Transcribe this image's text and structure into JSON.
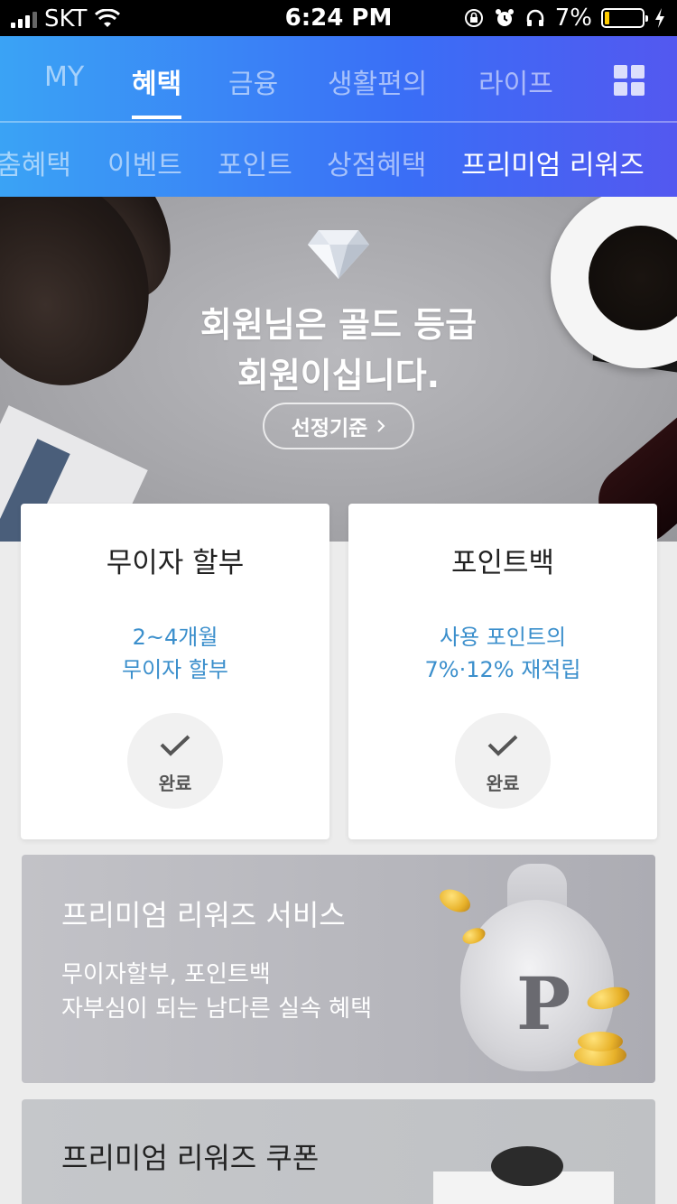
{
  "status_bar": {
    "carrier": "SKT",
    "time": "6:24 PM",
    "battery_percent": "7%"
  },
  "main_tabs": [
    {
      "label": "MY",
      "active": false
    },
    {
      "label": "혜택",
      "active": true
    },
    {
      "label": "금융",
      "active": false
    },
    {
      "label": "생활편의",
      "active": false
    },
    {
      "label": "라이프",
      "active": false
    }
  ],
  "sub_tabs": [
    {
      "label": "춤혜택",
      "active": false
    },
    {
      "label": "이벤트",
      "active": false
    },
    {
      "label": "포인트",
      "active": false
    },
    {
      "label": "상점혜택",
      "active": false
    },
    {
      "label": "프리미엄 리워즈",
      "active": true
    }
  ],
  "hero": {
    "line1": "회원님은 골드 등급",
    "line2": "회원이십니다.",
    "criteria_button": "선정기준"
  },
  "cards": [
    {
      "title": "무이자 할부",
      "desc_line1": "2~4개월",
      "desc_line2": "무이자 할부",
      "status": "완료"
    },
    {
      "title": "포인트백",
      "desc_line1": "사용 포인트의",
      "desc_line2": "7%·12% 재적립",
      "status": "완료"
    }
  ],
  "banners": {
    "service": {
      "title": "프리미엄 리워즈 서비스",
      "desc_line1": "무이자할부, 포인트백",
      "desc_line2": "자부심이 되는 남다른 실속 혜택",
      "bag_letter": "P"
    },
    "coupon": {
      "title": "프리미엄 리워즈 쿠폰"
    }
  },
  "colors": {
    "header_start": "#3aa3f5",
    "header_end": "#5358f0",
    "accent_text": "#3b8fcc"
  }
}
